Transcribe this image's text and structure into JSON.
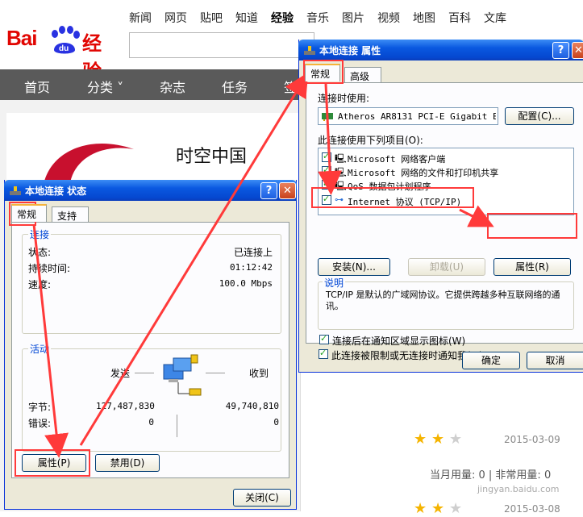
{
  "baidu": {
    "logo_bai": "Bai",
    "logo_du": "du",
    "logo_jingyan": "经验",
    "nav": [
      "新闻",
      "网页",
      "贴吧",
      "知道",
      "经验",
      "音乐",
      "图片",
      "视频",
      "地图",
      "百科",
      "文库"
    ],
    "nav_current": "经验",
    "menu": [
      "首页",
      "分类 ˅",
      "杂志",
      "任务",
      "签"
    ],
    "card_title": "时空中国",
    "date1": "2015-03-09",
    "useful": "当月用量: 0  |  非常用量: 0",
    "date2": "2015-03-08",
    "watermark": "jingyan.baidu.com"
  },
  "status_window": {
    "title": "本地连接 状态",
    "tabs": [
      "常规",
      "支持"
    ],
    "connection_group": "连接",
    "status_label": "状态:",
    "status_value": "已连接上",
    "duration_label": "持续时间:",
    "duration_value": "01:12:42",
    "speed_label": "速度:",
    "speed_value": "100.0 Mbps",
    "activity_group": "活动",
    "sent_label": "发送",
    "received_label": "收到",
    "bytes_label": "字节:",
    "bytes_sent": "127,487,830",
    "bytes_received": "49,740,810",
    "errors_label": "错误:",
    "errors_sent": "0",
    "errors_received": "0",
    "properties_button": "属性(P)",
    "disable_button": "禁用(D)",
    "close_button": "关闭(C)"
  },
  "props_window": {
    "title": "本地连接 属性",
    "tabs": [
      "常规",
      "高级"
    ],
    "connect_using_label": "连接时使用:",
    "adapter": "Atheros AR8131 PCI-E Gigabit E",
    "configure_button": "配置(C)...",
    "items_label": "此连接使用下列项目(O):",
    "items": [
      "Microsoft 网络客户端",
      "Microsoft 网络的文件和打印机共享",
      "QoS 数据包计划程序",
      "Internet 协议 (TCP/IP)"
    ],
    "install_button": "安装(N)...",
    "uninstall_button": "卸载(U)",
    "properties_button": "属性(R)",
    "description_group": "说明",
    "description": "TCP/IP 是默认的广域网协议。它提供跨越多种互联网络的通讯。",
    "check_notify": "连接后在通知区域显示图标(W)",
    "check_limited": "此连接被限制或无连接时通知我(M)",
    "ok_button": "确定",
    "cancel_button": "取消"
  },
  "colors": {
    "xp_title": "#0a58e0",
    "xp_face": "#ece9d8",
    "highlight_red": "#ff3a3a",
    "baidu_red": "#e10602"
  }
}
